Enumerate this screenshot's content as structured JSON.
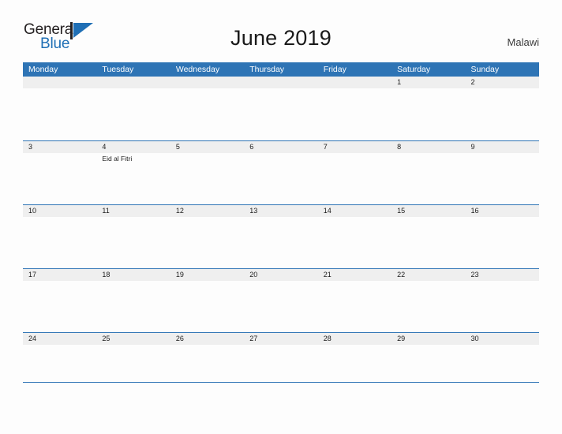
{
  "brand": {
    "name_part1": "General",
    "name_part2": "Blue",
    "mark_icon": "triangle-flag-icon",
    "accent_color": "#1f6fb5"
  },
  "header": {
    "title": "June 2019",
    "region": "Malawi"
  },
  "calendar": {
    "header_bg_color": "#2e74b5",
    "date_band_color": "#efefef",
    "weekdays": [
      "Monday",
      "Tuesday",
      "Wednesday",
      "Thursday",
      "Friday",
      "Saturday",
      "Sunday"
    ],
    "weeks": [
      {
        "days": [
          {
            "date": "",
            "event": ""
          },
          {
            "date": "",
            "event": ""
          },
          {
            "date": "",
            "event": ""
          },
          {
            "date": "",
            "event": ""
          },
          {
            "date": "",
            "event": ""
          },
          {
            "date": "1",
            "event": ""
          },
          {
            "date": "2",
            "event": ""
          }
        ]
      },
      {
        "days": [
          {
            "date": "3",
            "event": ""
          },
          {
            "date": "4",
            "event": "Eid al Fitri"
          },
          {
            "date": "5",
            "event": ""
          },
          {
            "date": "6",
            "event": ""
          },
          {
            "date": "7",
            "event": ""
          },
          {
            "date": "8",
            "event": ""
          },
          {
            "date": "9",
            "event": ""
          }
        ]
      },
      {
        "days": [
          {
            "date": "10",
            "event": ""
          },
          {
            "date": "11",
            "event": ""
          },
          {
            "date": "12",
            "event": ""
          },
          {
            "date": "13",
            "event": ""
          },
          {
            "date": "14",
            "event": ""
          },
          {
            "date": "15",
            "event": ""
          },
          {
            "date": "16",
            "event": ""
          }
        ]
      },
      {
        "days": [
          {
            "date": "17",
            "event": ""
          },
          {
            "date": "18",
            "event": ""
          },
          {
            "date": "19",
            "event": ""
          },
          {
            "date": "20",
            "event": ""
          },
          {
            "date": "21",
            "event": ""
          },
          {
            "date": "22",
            "event": ""
          },
          {
            "date": "23",
            "event": ""
          }
        ]
      },
      {
        "days": [
          {
            "date": "24",
            "event": ""
          },
          {
            "date": "25",
            "event": ""
          },
          {
            "date": "26",
            "event": ""
          },
          {
            "date": "27",
            "event": ""
          },
          {
            "date": "28",
            "event": ""
          },
          {
            "date": "29",
            "event": ""
          },
          {
            "date": "30",
            "event": ""
          }
        ]
      }
    ]
  }
}
